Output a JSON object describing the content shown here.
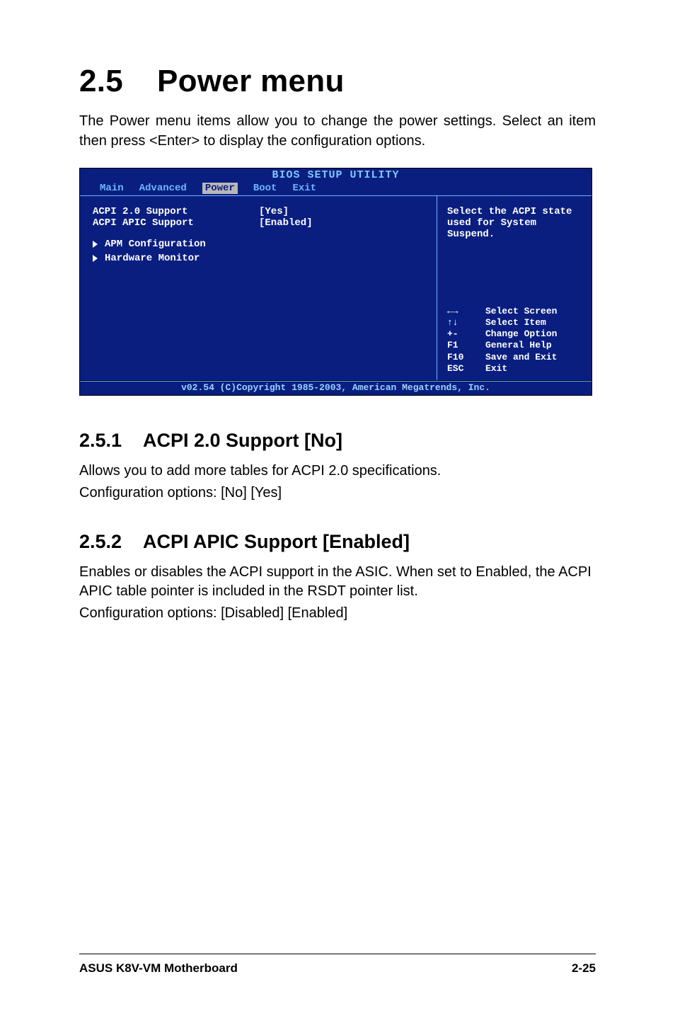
{
  "heading_number": "2.5",
  "heading_text": "Power menu",
  "intro_text": "The Power menu items allow you to change the power settings. Select an item then press <Enter> to display the configuration options.",
  "bios": {
    "title": "BIOS SETUP UTILITY",
    "tabs": {
      "t0": "Main",
      "t1": "Advanced",
      "t2": "Power",
      "t3": "Boot",
      "t4": "Exit"
    },
    "selected_tab_index": 2,
    "left": {
      "item0_label": "ACPI 2.0 Support",
      "item0_value": "[Yes]",
      "item1_label": "ACPI APIC Support",
      "item1_value": "[Enabled]",
      "sub0": "APM Configuration",
      "sub1": "Hardware Monitor"
    },
    "right": {
      "help_line1": "Select the ACPI state",
      "help_line2": "used for System",
      "help_line3": "Suspend.",
      "k0_key": "←→",
      "k0_txt": "Select Screen",
      "k1_key": "↑↓",
      "k1_txt": "Select Item",
      "k2_key": "+-",
      "k2_txt": "Change Option",
      "k3_key": "F1",
      "k3_txt": "General Help",
      "k4_key": "F10",
      "k4_txt": "Save and Exit",
      "k5_key": "ESC",
      "k5_txt": "Exit"
    },
    "footer": "v02.54 (C)Copyright 1985-2003, American Megatrends, Inc."
  },
  "s1_num": "2.5.1",
  "s1_title": "ACPI 2.0 Support [No]",
  "s1_p1": "Allows you to add more tables for ACPI 2.0 specifications.",
  "s1_p2": "Configuration options: [No] [Yes]",
  "s2_num": "2.5.2",
  "s2_title": "ACPI APIC Support [Enabled]",
  "s2_p1": "Enables or disables the ACPI support in the ASIC. When set to Enabled, the ACPI APIC table pointer is included in the RSDT pointer list.",
  "s2_p2": "Configuration options: [Disabled] [Enabled]",
  "footer_left": "ASUS K8V-VM Motherboard",
  "footer_right": "2-25"
}
